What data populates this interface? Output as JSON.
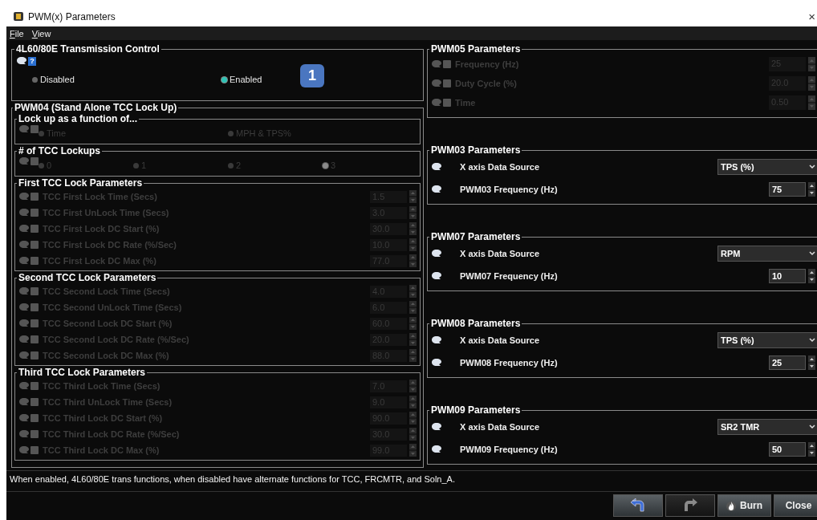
{
  "window": {
    "title": "PWM(x) Parameters",
    "close": "×"
  },
  "menu": [
    {
      "label": "File"
    },
    {
      "label": "View"
    }
  ],
  "transmission": {
    "title": "4L60/80E Transmission Control",
    "help": "?",
    "badge": "1",
    "disabled": false,
    "options": [
      {
        "label": "Disabled",
        "selected": false
      },
      {
        "label": "Enabled",
        "selected": true
      }
    ]
  },
  "pwm04": {
    "title": "PWM04 (Stand Alone TCC Lock Up)",
    "radio_groups": [
      {
        "title": "Lock up as a function of...",
        "disabled": true,
        "options": [
          {
            "label": "Time",
            "selected": false
          },
          {
            "label": "MPH & TPS%",
            "selected": false
          }
        ]
      },
      {
        "title": "# of TCC Lockups",
        "disabled": true,
        "options": [
          {
            "label": "0",
            "selected": false
          },
          {
            "label": "1",
            "selected": false
          },
          {
            "label": "2",
            "selected": false
          },
          {
            "label": "3",
            "selected": true
          }
        ]
      }
    ],
    "param_groups": [
      {
        "title": "First TCC Lock Parameters",
        "disabled": true,
        "params": [
          {
            "label": "TCC First Lock Time (Secs)",
            "value": "1.5"
          },
          {
            "label": "TCC First UnLock Time (Secs)",
            "value": "3.0"
          },
          {
            "label": "TCC First Lock DC Start (%)",
            "value": "30.0"
          },
          {
            "label": "TCC First Lock DC Rate (%/Sec)",
            "value": "10.0"
          },
          {
            "label": "TCC First Lock DC Max (%)",
            "value": "77.0"
          }
        ]
      },
      {
        "title": "Second TCC Lock Parameters",
        "disabled": true,
        "params": [
          {
            "label": "TCC Second Lock Time (Secs)",
            "value": "4.0"
          },
          {
            "label": "TCC Second UnLock Time (Secs)",
            "value": "6.0"
          },
          {
            "label": "TCC Second Lock DC Start (%)",
            "value": "60.0"
          },
          {
            "label": "TCC Second Lock DC Rate (%/Sec)",
            "value": "20.0"
          },
          {
            "label": "TCC Second Lock DC Max (%)",
            "value": "88.0"
          }
        ]
      },
      {
        "title": "Third TCC Lock Parameters",
        "disabled": true,
        "params": [
          {
            "label": "TCC Third Lock Time (Secs)",
            "value": "7.0"
          },
          {
            "label": "TCC Third UnLock Time (Secs)",
            "value": "9.0"
          },
          {
            "label": "TCC Third Lock DC Start (%)",
            "value": "90.0"
          },
          {
            "label": "TCC Third Lock DC Rate (%/Sec)",
            "value": "30.0"
          },
          {
            "label": "TCC Third Lock DC Max (%)",
            "value": "99.0"
          }
        ]
      }
    ]
  },
  "right_groups": [
    {
      "title": "PWM05 Parameters",
      "disabled": true,
      "rows": [
        {
          "kind": "number",
          "label": "Frequency (Hz)",
          "value": "25"
        },
        {
          "kind": "number",
          "label": "Duty Cycle (%)",
          "value": "20.0"
        },
        {
          "kind": "number",
          "label": "Time",
          "value": "0.50"
        }
      ]
    },
    {
      "title": "PWM03 Parameters",
      "disabled": false,
      "rows": [
        {
          "kind": "select",
          "label": "X axis Data Source",
          "value": "TPS (%)"
        },
        {
          "kind": "number",
          "label": "PWM03 Frequency (Hz)",
          "value": "75"
        }
      ]
    },
    {
      "title": "PWM07 Parameters",
      "disabled": false,
      "rows": [
        {
          "kind": "select",
          "label": "X axis Data Source",
          "value": "RPM"
        },
        {
          "kind": "number",
          "label": "PWM07 Frequency (Hz)",
          "value": "10"
        }
      ]
    },
    {
      "title": "PWM08 Parameters",
      "disabled": false,
      "rows": [
        {
          "kind": "select",
          "label": "X axis Data Source",
          "value": "TPS (%)"
        },
        {
          "kind": "number",
          "label": "PWM08 Frequency (Hz)",
          "value": "25"
        }
      ]
    },
    {
      "title": "PWM09 Parameters",
      "disabled": false,
      "rows": [
        {
          "kind": "select",
          "label": "X axis Data Source",
          "value": "SR2 TMR"
        },
        {
          "kind": "number",
          "label": "PWM09 Frequency (Hz)",
          "value": "50"
        }
      ]
    }
  ],
  "status": "When enabled, 4L60/80E trans functions, when disabled have alternate functions for TCC, FRCMTR, and Soln_A.",
  "buttons": [
    {
      "kind": "undo",
      "disabled": false
    },
    {
      "kind": "redo",
      "disabled": true
    },
    {
      "kind": "burn",
      "label": "Burn",
      "disabled": false
    },
    {
      "kind": "close",
      "label": "Close",
      "disabled": false
    }
  ]
}
